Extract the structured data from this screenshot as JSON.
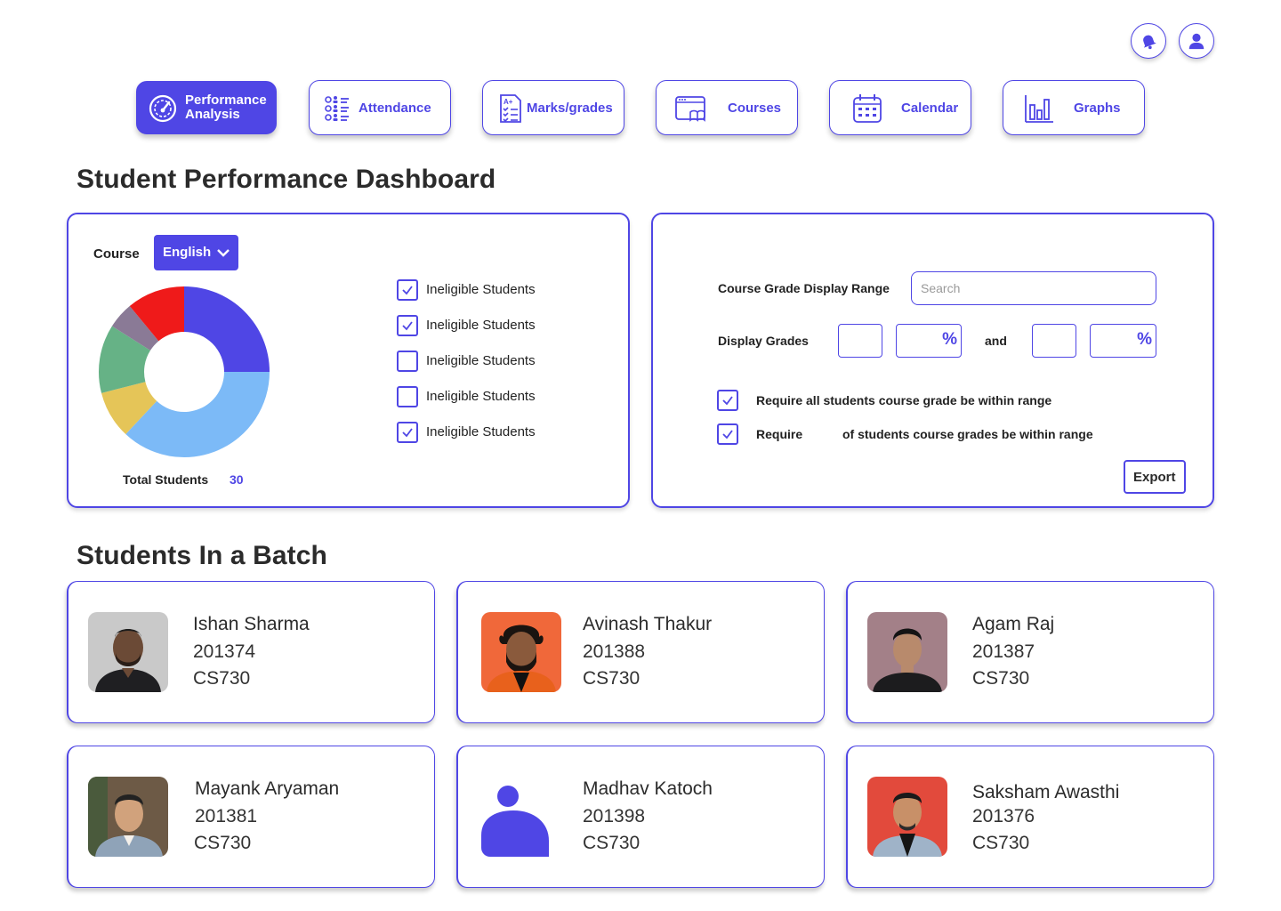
{
  "header": {
    "icons": [
      "bell-icon",
      "user-icon"
    ]
  },
  "nav": [
    {
      "label": "Performance Analysis",
      "line1": "Performance",
      "line2": "Analysis",
      "icon": "speedometer-icon",
      "active": true
    },
    {
      "label": "Attendance",
      "icon": "checklist-icon",
      "active": false
    },
    {
      "label": "Marks/grades",
      "icon": "grades-document-icon",
      "active": false
    },
    {
      "label": "Courses",
      "icon": "course-book-icon",
      "active": false
    },
    {
      "label": "Calendar",
      "icon": "calendar-icon",
      "active": false
    },
    {
      "label": "Graphs",
      "icon": "bar-graph-icon",
      "active": false
    }
  ],
  "dashboard": {
    "title": "Student Performance Dashboard",
    "course_label": "Course",
    "course_value": "English",
    "total_label": "Total Students",
    "total_value": "30",
    "filters": [
      {
        "label": "Ineligible Students",
        "checked": true
      },
      {
        "label": "Ineligible Students",
        "checked": true
      },
      {
        "label": "Ineligible Students",
        "checked": false
      },
      {
        "label": "Ineligible Students",
        "checked": false
      },
      {
        "label": "Ineligible Students",
        "checked": true
      }
    ]
  },
  "chart_data": {
    "type": "pie",
    "donut": true,
    "slices": [
      {
        "value": 25,
        "color": "#4f46e5"
      },
      {
        "value": 37,
        "color": "#7cbaf7"
      },
      {
        "value": 9,
        "color": "#e5c558"
      },
      {
        "value": 13,
        "color": "#66b286"
      },
      {
        "value": 5,
        "color": "#8a7a96"
      },
      {
        "value": 11,
        "color": "#ef1a1a"
      }
    ]
  },
  "range": {
    "range_label": "Course Grade Display Range",
    "search_placeholder": "Search",
    "display_label": "Display Grades",
    "percent_symbol": "%",
    "and_label": "and",
    "require_all_label": "Require all students course grade be within range",
    "require_all_checked": true,
    "require_label": "Require",
    "require_suffix": "of students course grades be within range",
    "require_checked": true,
    "export_label": "Export"
  },
  "batch": {
    "title": "Students In a Batch",
    "students": [
      {
        "name": "Ishan Sharma",
        "id": "201374",
        "course": "CS730",
        "photo": "photo-portrait"
      },
      {
        "name": "Avinash Thakur",
        "id": "201388",
        "course": "CS730",
        "photo": "photo-portrait"
      },
      {
        "name": "Agam Raj",
        "id": "201387",
        "course": "CS730",
        "photo": "photo-portrait"
      },
      {
        "name": "Mayank Aryaman",
        "id": "201381",
        "course": "CS730",
        "photo": "photo-portrait"
      },
      {
        "name": "Madhav Katoch",
        "id": "201398",
        "course": "CS730",
        "photo": "avatar-placeholder-icon"
      },
      {
        "name": "Saksham Awasthi",
        "id": "201376",
        "course": "CS730",
        "photo": "photo-portrait"
      }
    ]
  },
  "colors": {
    "accent": "#4f46e5",
    "text": "#2b2b2b"
  }
}
